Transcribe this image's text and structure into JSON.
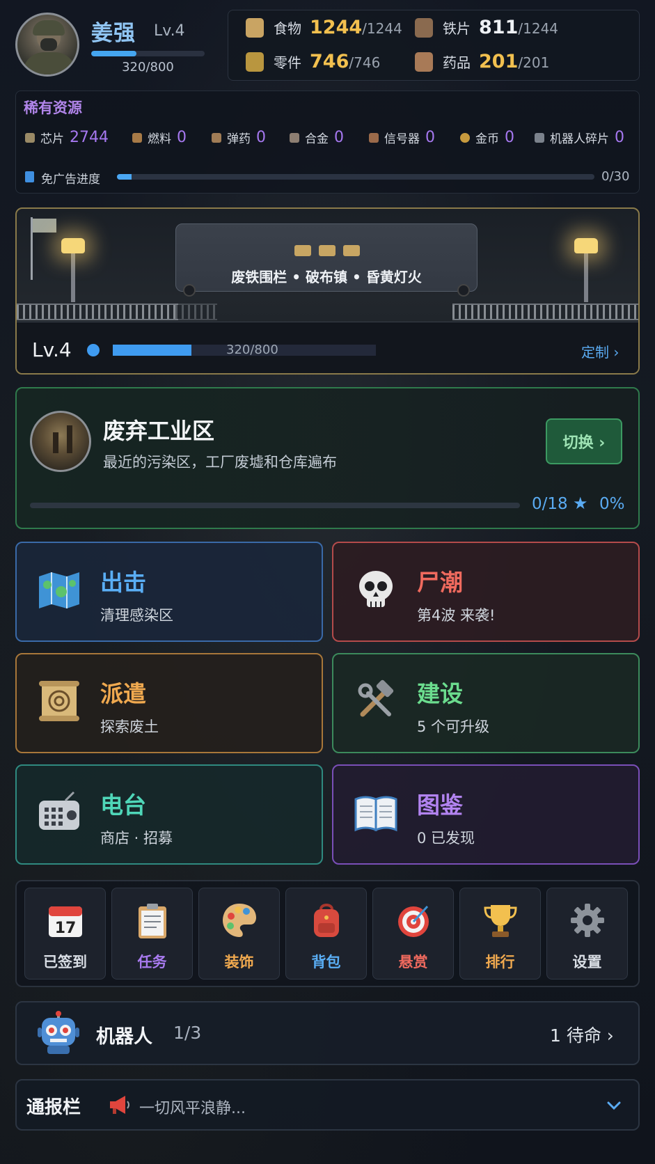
{
  "player": {
    "name": "姜强",
    "level": "Lv.4",
    "xp_text": "320/800",
    "xp_fraction": 0.4
  },
  "resources": [
    {
      "name": "食物",
      "value": "1244",
      "max": "/1244",
      "color": "#f2c04f",
      "icon": "food-icon"
    },
    {
      "name": "铁片",
      "value": "811",
      "max": "/1244",
      "color": "#eef1f5",
      "icon": "iron-icon"
    },
    {
      "name": "零件",
      "value": "746",
      "max": "/746",
      "color": "#f2c04f",
      "icon": "parts-icon"
    },
    {
      "name": "药品",
      "value": "201",
      "max": "/201",
      "color": "#f2c04f",
      "icon": "medicine-icon"
    }
  ],
  "rare": {
    "title": "稀有资源",
    "items": [
      {
        "name": "芯片",
        "value": "2744",
        "icon": "chip-icon"
      },
      {
        "name": "燃料",
        "value": "0",
        "icon": "fuel-icon"
      },
      {
        "name": "弹药",
        "value": "0",
        "icon": "ammo-icon"
      },
      {
        "name": "合金",
        "value": "0",
        "icon": "alloy-icon"
      },
      {
        "name": "信号器",
        "value": "0",
        "icon": "signal-icon"
      },
      {
        "name": "金币",
        "value": "0",
        "icon": "coin-icon"
      },
      {
        "name": "机器人碎片",
        "value": "0",
        "icon": "robot-fragment-icon"
      }
    ],
    "ad_label": "免广告进度",
    "ad_progress_text": "0/30",
    "ad_fraction": 0.03
  },
  "base": {
    "sign_text": "废铁围栏 • 破布镇 • 昏黄灯火",
    "level": "Lv.4",
    "xp_text": "320/800",
    "xp_fraction": 0.3,
    "customize_label": "定制 ›"
  },
  "zone": {
    "title": "废弃工业区",
    "description": "最近的污染区，工厂废墟和仓库遍布",
    "switch_label": "切换 ›",
    "progress_text": "0/18",
    "star": "★",
    "percent": "0%",
    "progress_fraction": 0
  },
  "tiles": [
    {
      "title": "出击",
      "subtitle": "清理感染区",
      "color": "#5aaef5",
      "icon": "map-icon"
    },
    {
      "title": "尸潮",
      "subtitle": "第4波 来袭!",
      "color": "#f06a5e",
      "icon": "skull-icon"
    },
    {
      "title": "派遣",
      "subtitle": "探索废土",
      "color": "#f0a94f",
      "icon": "scroll-target-icon"
    },
    {
      "title": "建设",
      "subtitle": "5 个可升级",
      "color": "#6bdc8e",
      "icon": "hammer-wrench-icon"
    },
    {
      "title": "电台",
      "subtitle": "商店 · 招募",
      "color": "#4fd6b8",
      "icon": "radio-icon"
    },
    {
      "title": "图鉴",
      "subtitle": "0 已发现",
      "color": "#b283f0",
      "icon": "book-icon"
    }
  ],
  "quick": [
    {
      "label": "已签到",
      "color": "#d9dee5",
      "glyph": "17",
      "icon": "calendar-icon"
    },
    {
      "label": "任务",
      "color": "#a97bf0",
      "glyph": "📋",
      "icon": "clipboard-icon"
    },
    {
      "label": "装饰",
      "color": "#f0a94f",
      "glyph": "🎨",
      "icon": "palette-icon"
    },
    {
      "label": "背包",
      "color": "#5aaef5",
      "glyph": "🎒",
      "icon": "backpack-icon"
    },
    {
      "label": "悬赏",
      "color": "#f06a5e",
      "glyph": "🎯",
      "icon": "target-icon"
    },
    {
      "label": "排行",
      "color": "#f0a94f",
      "glyph": "🏆",
      "icon": "trophy-icon"
    },
    {
      "label": "设置",
      "color": "#d9dee5",
      "glyph": "⚙",
      "icon": "gear-icon"
    }
  ],
  "robot": {
    "label": "机器人",
    "count": "1/3",
    "status": "1 待命 ›"
  },
  "news": {
    "title": "通报栏",
    "text": "一切风平浪静..."
  }
}
